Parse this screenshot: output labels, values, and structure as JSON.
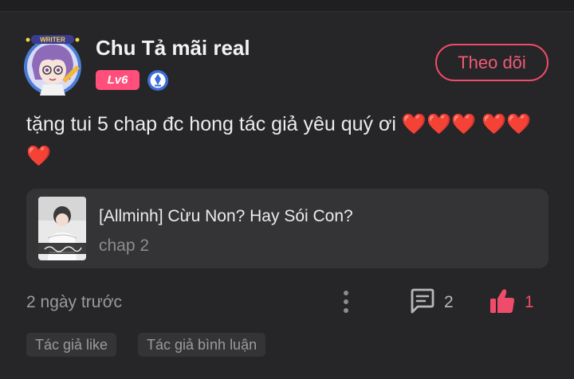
{
  "user": {
    "name": "Chu Tả mãi real",
    "level": "Lv6",
    "avatar_badge_text": "WRITER"
  },
  "follow_button_label": "Theo dõi",
  "comment": {
    "text": "tặng tui 5 chap đc hong tác giả yêu quý ơi ❤️❤️❤️ ❤️❤️❤️"
  },
  "story": {
    "title": "[Allminh] Cừu Non? Hay Sói Con?",
    "chapter": "chap 2"
  },
  "footer": {
    "time": "2 ngày trước",
    "comment_count": "2",
    "like_count": "1"
  },
  "tags": [
    "Tác giả like",
    "Tác giả bình luận"
  ],
  "colors": {
    "background": "#262527",
    "accent": "#ef4c6b",
    "level_badge": "#ff4f7a",
    "card": "#343335",
    "muted_text": "#9b9a9d"
  },
  "icons": [
    "writer-avatar",
    "medal-icon",
    "more-vertical-icon",
    "comment-icon",
    "thumbs-up-icon"
  ]
}
